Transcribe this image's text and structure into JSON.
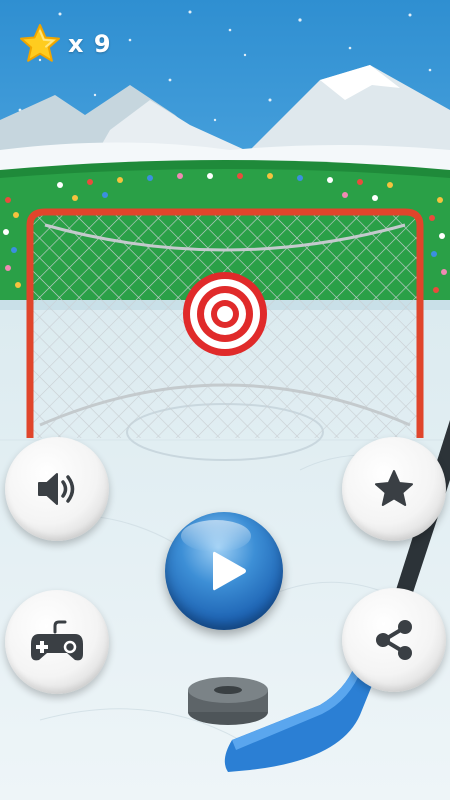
{
  "hud": {
    "star_count_text": "x 9",
    "star_icon": "star-icon"
  },
  "buttons": {
    "sound": {
      "icon": "speaker-icon"
    },
    "rate": {
      "icon": "star-icon"
    },
    "play": {
      "icon": "play-icon"
    },
    "games": {
      "icon": "gamepad-icon"
    },
    "share": {
      "icon": "share-icon"
    }
  },
  "colors": {
    "sky": "#2f8fd1",
    "goal_frame": "#e0452b",
    "target_red": "#e02a2a",
    "play_button": "#1e64b4",
    "hud_star": "#ffcc1f",
    "stick_blue": "#2b7fd4"
  }
}
